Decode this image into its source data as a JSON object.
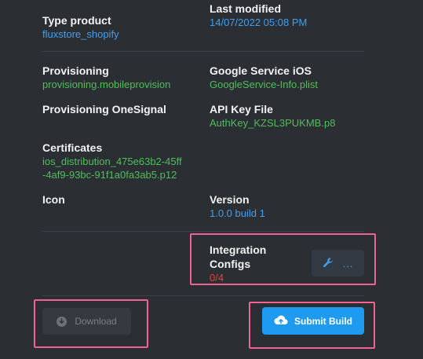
{
  "fields": {
    "type_product": {
      "label": "Type product",
      "value": "fluxstore_shopify"
    },
    "last_modified": {
      "label": "Last modified",
      "value": "14/07/2022 05:08 PM"
    },
    "provisioning": {
      "label": "Provisioning",
      "value": "provisioning.mobileprovision"
    },
    "google_service": {
      "label": "Google Service iOS",
      "value": "GoogleService-Info.plist"
    },
    "provisioning_onesignal": {
      "label": "Provisioning OneSignal"
    },
    "api_key_file": {
      "label": "API Key File",
      "value": "AuthKey_KZSL3PUKMB.p8"
    },
    "certificates": {
      "label": "Certificates",
      "value_line1": "ios_distribution_475e63b2-45ff",
      "value_line2": "-4af9-93bc-91f1a0fa3ab5.p12"
    },
    "icon": {
      "label": "Icon"
    },
    "version": {
      "label": "Version",
      "value": "1.0.0 build 1"
    },
    "integration_configs": {
      "label_line1": "Integration",
      "label_line2": "Configs",
      "value": "0/4"
    }
  },
  "buttons": {
    "configure_dots": "...",
    "download_label": "Download",
    "submit_label": "Submit Build"
  },
  "icons": {
    "configure": "wrench-icon",
    "download": "download-circle-icon",
    "submit": "cloud-upload-icon"
  },
  "colors": {
    "background": "#2b2e33",
    "link_blue": "#3ea0f0",
    "file_green": "#4fbf5a",
    "count_red": "#e5433f",
    "submit_bg": "#1e9bf0",
    "highlight": "#f06292"
  }
}
